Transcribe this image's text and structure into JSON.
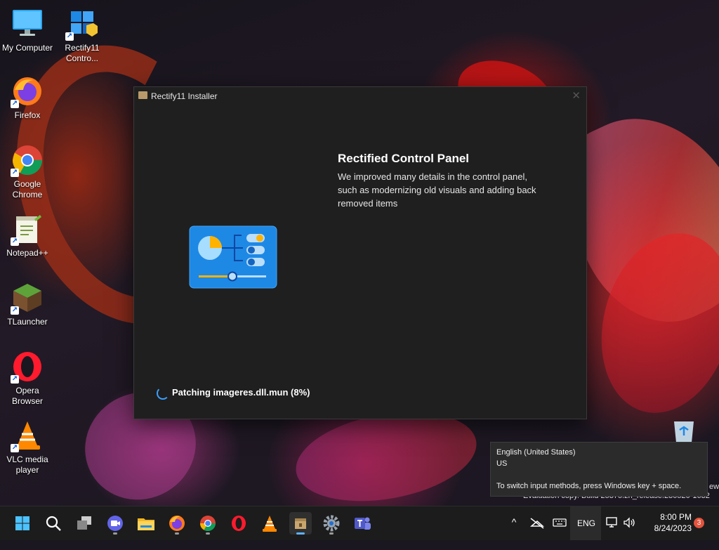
{
  "desktop": {
    "icons": [
      {
        "label": "My Computer",
        "icon": "monitor-icon"
      },
      {
        "label": "Rectify11 Contro...",
        "icon": "control-panel-icon"
      },
      {
        "label": "Firefox",
        "icon": "firefox-icon"
      },
      {
        "label": "Google Chrome",
        "icon": "chrome-icon"
      },
      {
        "label": "Notepad++",
        "icon": "notepadpp-icon"
      },
      {
        "label": "TLauncher",
        "icon": "tlauncher-icon"
      },
      {
        "label": "Opera Browser",
        "icon": "opera-icon"
      },
      {
        "label": "VLC media player",
        "icon": "vlc-icon"
      }
    ]
  },
  "installer": {
    "title": "Rectify11 Installer",
    "close": "✕",
    "heading": "Rectified Control Panel",
    "description": "We improved many details in the control panel, such as modernizing old visuals and adding back removed items",
    "status": "Patching imageres.dll.mun (8%)",
    "progress_percent": 8
  },
  "tooltip": {
    "line1": "English (United States)",
    "line2": "US",
    "line3": "To switch input methods, press Windows key + space."
  },
  "watermark": {
    "line1": "Evaluation copy. Build 25375.zn_release.230520-1632",
    "suffix": "ew"
  },
  "taskbar": {
    "apps": [
      "start-icon",
      "search-icon",
      "task-view-icon",
      "meet-icon",
      "file-explorer-icon",
      "firefox-icon",
      "chrome-icon",
      "opera-icon",
      "vlc-icon",
      "installer-icon",
      "settings-icon",
      "teams-icon"
    ],
    "active_app": "installer-icon",
    "tray": {
      "chevron": "^",
      "language": "ENG",
      "time": "8:00 PM",
      "date": "8/24/2023",
      "notifications": "3"
    }
  },
  "colors": {
    "accent": "#3aa0ff",
    "window_bg": "#1f1f1f",
    "taskbar_bg": "#1c1c1c",
    "badge": "#e2533d"
  }
}
